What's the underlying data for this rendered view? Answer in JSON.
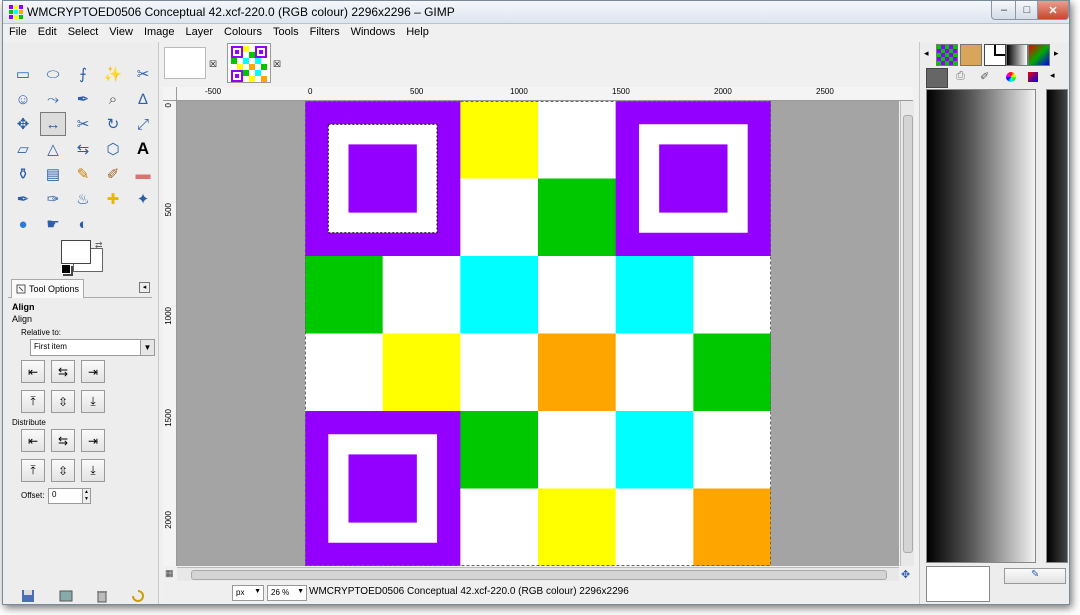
{
  "window": {
    "title": "WMCRYPTOED0506 Conceptual 42.xcf-220.0 (RGB colour) 2296x2296 – GIMP",
    "buttons": {
      "minimize": "–",
      "maximize": "□",
      "close": "✕"
    }
  },
  "menubar": [
    "File",
    "Edit",
    "Select",
    "View",
    "Image",
    "Layer",
    "Colours",
    "Tools",
    "Filters",
    "Windows",
    "Help"
  ],
  "toolbox": {
    "tool_icons": [
      "rect-select-icon",
      "ellipse-select-icon",
      "free-select-icon",
      "fuzzy-select-icon",
      "scissors-select-icon",
      "foreground-select-icon",
      "paths-icon",
      "color-picker-icon",
      "zoom-icon",
      "measure-icon",
      "move-icon",
      "align-icon",
      "crop-icon",
      "rotate-icon",
      "scale-icon",
      "shear-icon",
      "perspective-icon",
      "flip-icon",
      "cage-transform-icon",
      "text-icon",
      "bucket-fill-icon",
      "blend-icon",
      "pencil-icon",
      "paintbrush-icon",
      "eraser-icon",
      "airbrush-icon",
      "ink-icon",
      "clone-icon",
      "heal-icon",
      "perspective-clone-icon",
      "blur-icon",
      "smudge-icon",
      "dodge-burn-icon"
    ],
    "active_tool": "align-icon"
  },
  "tool_options": {
    "tab_label": "Tool Options",
    "title": "Align",
    "subtitle": "Align",
    "relative_to_label": "Relative to:",
    "relative_to_value": "First item",
    "distribute_label": "Distribute",
    "offset_label": "Offset:",
    "offset_value": "0"
  },
  "image": {
    "grid_colors": [
      [
        "#9400ff",
        "#9400ff",
        "#ffff00",
        "#ffffff",
        "#9400ff",
        "#9400ff"
      ],
      [
        "#9400ff",
        "#9400ff",
        "#ffffff",
        "#00c800",
        "#9400ff",
        "#9400ff"
      ],
      [
        "#00c800",
        "#ffffff",
        "#00ffff",
        "#ffffff",
        "#00ffff",
        "#ffffff"
      ],
      [
        "#ffffff",
        "#ffff00",
        "#ffffff",
        "#ffa500",
        "#ffffff",
        "#00c800"
      ],
      [
        "#9400ff",
        "#9400ff",
        "#00c800",
        "#ffffff",
        "#00ffff",
        "#ffffff"
      ],
      [
        "#9400ff",
        "#9400ff",
        "#ffffff",
        "#ffff00",
        "#ffffff",
        "#ffa500"
      ]
    ],
    "finder_colors": {
      "outer": "#9400ff",
      "ring": "#ffffff",
      "inner": "#9400ff"
    }
  },
  "ruler": {
    "h_labels": [
      "-500",
      "0",
      "500",
      "1000",
      "1500",
      "2000",
      "2500"
    ],
    "v_labels": [
      "0",
      "500",
      "1000",
      "1500",
      "2000"
    ]
  },
  "statusbar": {
    "unit": "px",
    "zoom": "26 %",
    "text": "WMCRYPTOED0506 Conceptual 42.xcf-220.0 (RGB colour) 2296x2296"
  },
  "dock": {
    "top_icons": [
      "patterns-icon",
      "brushes-icon",
      "fonts-icon",
      "gradients-icon",
      "palette-icon"
    ],
    "tabs_row2": [
      "tool-presets-icon",
      "printer-icon",
      "paintbrush-tab-icon",
      "color-wheel-icon",
      "palette-tab-icon"
    ]
  }
}
